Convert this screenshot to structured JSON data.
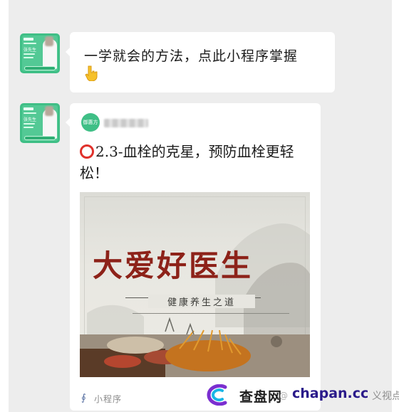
{
  "message1": {
    "text": "一学就会的方法，点此小程序掌握"
  },
  "avatar": {
    "name_label": "张先生"
  },
  "mini_program_card": {
    "logo_text": "御惠方",
    "title": "2.3-血栓的克星，预防血栓更轻松！",
    "cover": {
      "headline": "大爱好医生",
      "subtitle": "健康养生之道"
    },
    "footer_label": "小程序"
  },
  "watermark": {
    "cn": "查盘网",
    "en": "chapan.cc",
    "faded_left": "@",
    "faded_right": "义视点"
  },
  "colors": {
    "chat_background": "#ededed",
    "bubble": "#ffffff",
    "brand_green": "#3fbf86",
    "headline_red": "#8d2219",
    "badge_red": "#e0312b"
  }
}
